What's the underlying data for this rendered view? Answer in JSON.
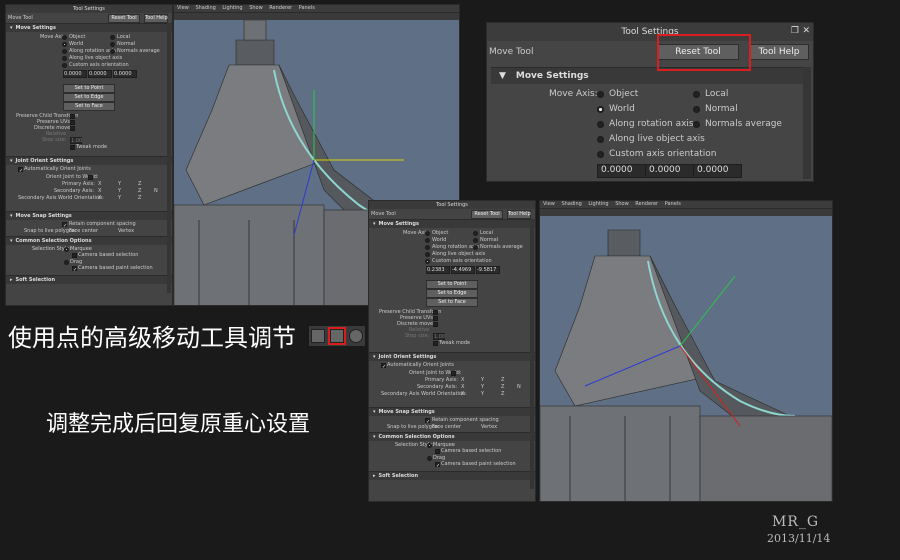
{
  "tool_settings": {
    "title": "Tool Settings",
    "tool_name": "Move Tool",
    "reset_label": "Reset Tool",
    "help_label": "Tool Help"
  },
  "move_settings": {
    "header": "Move Settings",
    "axis_label": "Move Axis:",
    "object": "Object",
    "local": "Local",
    "world": "World",
    "normal": "Normal",
    "along_rotation": "Along rotation axis",
    "normals_average": "Normals average",
    "along_live": "Along live object axis",
    "custom_axis": "Custom axis orientation",
    "fields_zero": [
      "0.0000",
      "0.0000",
      "0.0000"
    ],
    "fields_custom": [
      "0.2383",
      "-4.4969",
      "-9.5817"
    ],
    "set_point": "Set to Point",
    "set_edge": "Set to Edge",
    "set_face": "Set to Face",
    "preserve_child": "Preserve Child Transform",
    "preserve_uvs": "Preserve UVs",
    "discrete_move": "Discrete move:",
    "relative": "Relative",
    "step_size": "Step size:",
    "step_val": "1.00",
    "tweak_mode": "Tweak mode"
  },
  "joint_orient": {
    "header": "Joint Orient Settings",
    "auto": "Automatically Orient Joints",
    "orient_world": "Orient Joint to World:",
    "primary": "Primary Axis:",
    "secondary": "Secondary Axis:",
    "secondary_world": "Secondary Axis World Orientation:",
    "x": "X",
    "y": "Y",
    "z": "Z",
    "none": "N"
  },
  "move_snap": {
    "header": "Move Snap Settings",
    "retain": "Retain component spacing",
    "snap_live": "Snap to live polygon:",
    "face_center": "Face center",
    "vertex": "Vertex"
  },
  "common_selection": {
    "header": "Common Selection Options",
    "style": "Selection Style:",
    "marquee": "Marquee",
    "camera_based": "Camera based selection",
    "drag": "Drag",
    "camera_paint": "Camera based paint selection"
  },
  "soft_selection": {
    "header": "Soft Selection"
  },
  "viewport_menu": [
    "View",
    "Shading",
    "Lighting",
    "Show",
    "Renderer",
    "Panels"
  ],
  "captions": {
    "line1": "使用点的高级移动工具调节",
    "line2": "调整完成后回复原重心设置"
  },
  "signature": {
    "name": "MR_G",
    "date": "2013/11/14"
  },
  "colors": {
    "highlight_red": "#d81e1e",
    "viewport_bg": "#5f6f85"
  }
}
